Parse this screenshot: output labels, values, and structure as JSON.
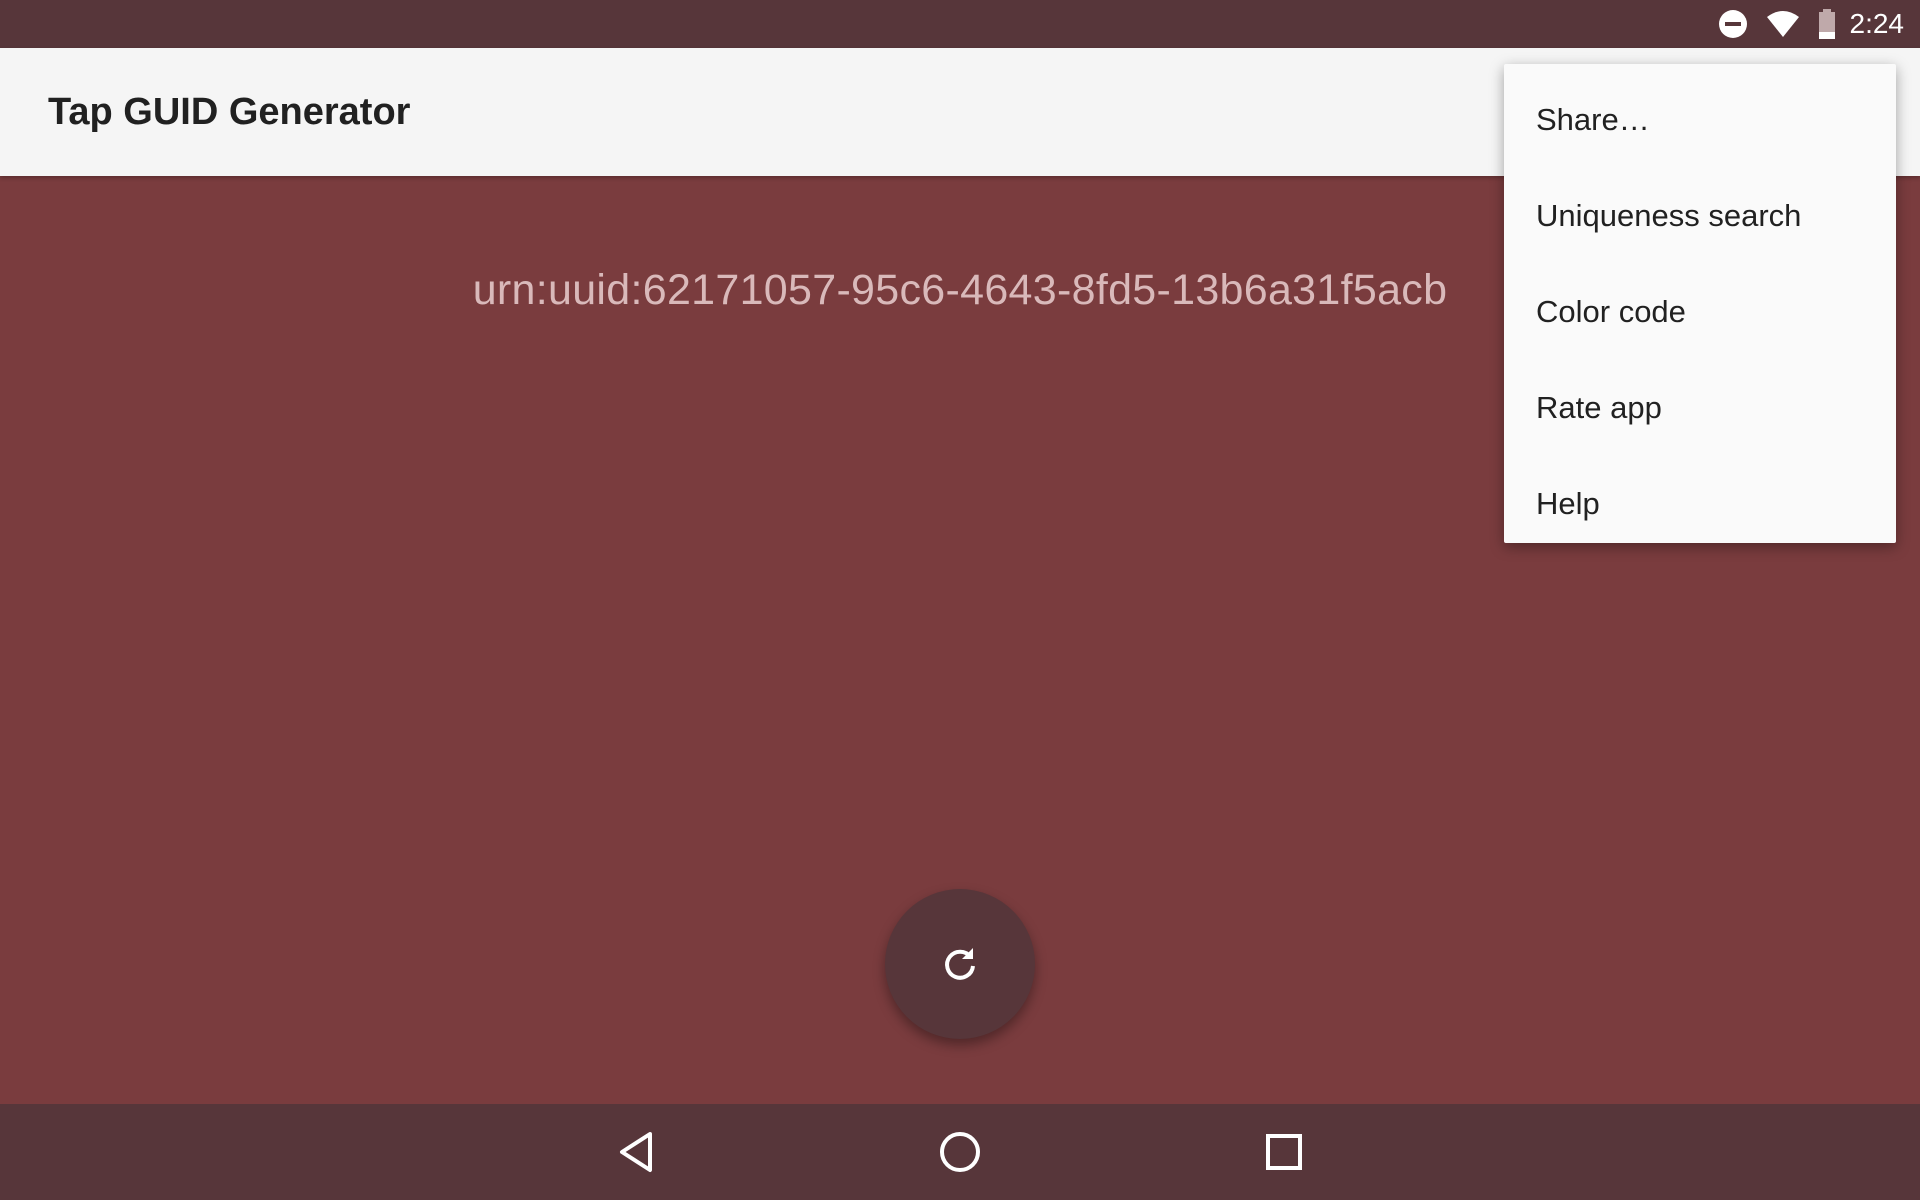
{
  "status_bar": {
    "time": "2:24",
    "icons": [
      "do-not-disturb-icon",
      "wifi-icon",
      "battery-icon"
    ]
  },
  "app_bar": {
    "title": "Tap GUID Generator"
  },
  "main": {
    "guid": "urn:uuid:62171057-95c6-4643-8fd5-13b6a31f5acb"
  },
  "fab": {
    "icon": "refresh-icon"
  },
  "overflow_menu": {
    "items": [
      {
        "label": "Share…"
      },
      {
        "label": "Uniqueness search"
      },
      {
        "label": "Color code"
      },
      {
        "label": "Rate app"
      },
      {
        "label": "Help"
      }
    ]
  },
  "nav_bar": {
    "icons": [
      "back-icon",
      "home-icon",
      "recents-icon"
    ]
  },
  "colors": {
    "background": "#7a3c3e",
    "status_bar": "#57363a",
    "app_bar": "#f5f5f5",
    "guid_text": "#d9b9ba",
    "fab": "#57363a",
    "menu": "#fafafa"
  }
}
